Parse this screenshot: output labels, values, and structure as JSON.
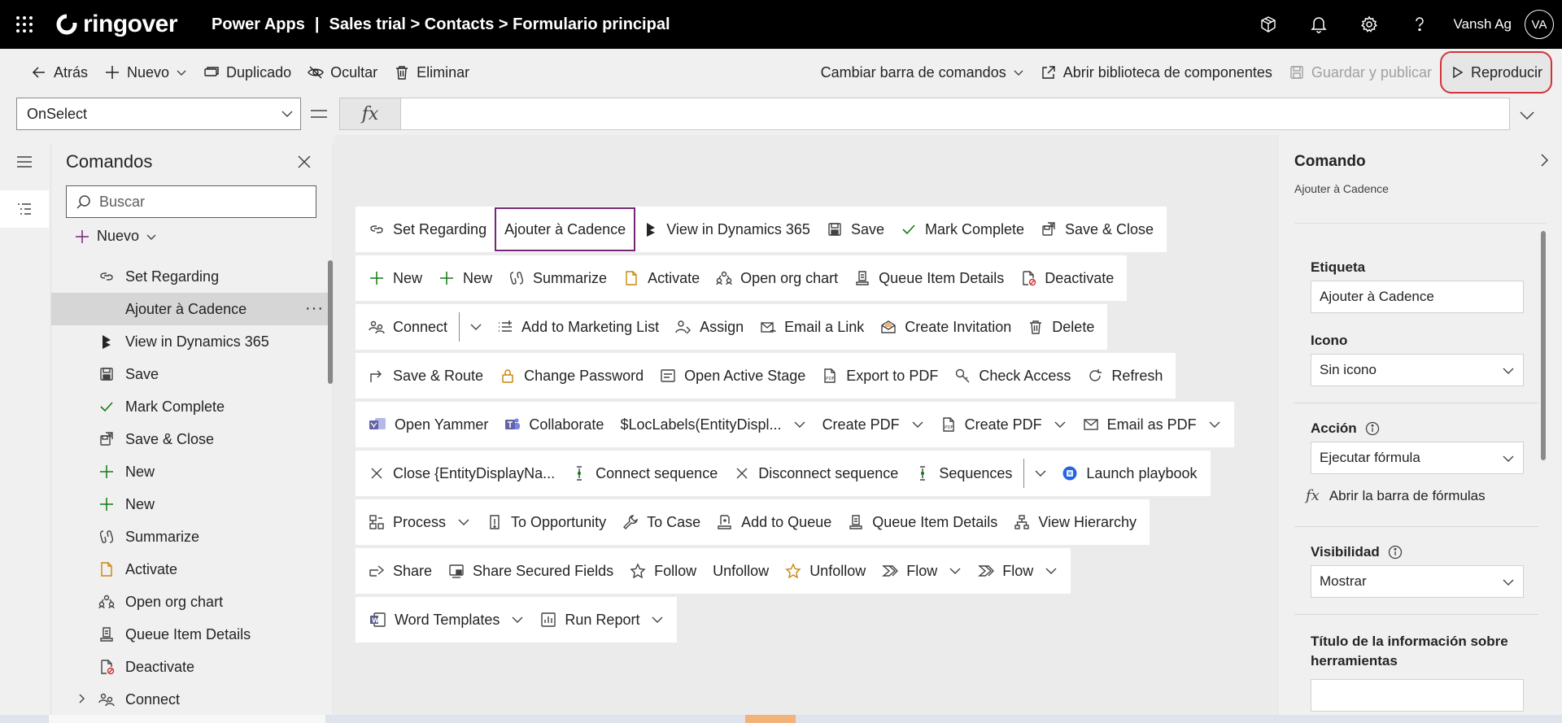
{
  "header": {
    "brand": "ringover",
    "app_name": "Power Apps",
    "separator": "|",
    "breadcrumb": "Sales trial > Contacts > Formulario principal",
    "user_name": "Vansh Ag",
    "user_initials": "VA",
    "icons": [
      "waffle-icon",
      "environment-icon",
      "bell-icon",
      "gear-icon",
      "help-icon"
    ]
  },
  "toolbar": {
    "back": "Atrás",
    "new": "Nuevo",
    "duplicate": "Duplicado",
    "hide": "Ocultar",
    "delete": "Eliminar",
    "change_commandbar": "Cambiar barra de comandos",
    "open_library": "Abrir biblioteca de componentes",
    "save_publish": "Guardar y publicar",
    "play": "Reproducir"
  },
  "formula_bar": {
    "property": "OnSelect",
    "fx": "fx",
    "formula": ""
  },
  "commands_panel": {
    "title": "Comandos",
    "search_placeholder": "Buscar",
    "new_label": "Nuevo",
    "items": [
      {
        "label": "Set Regarding",
        "icon": "link-icon"
      },
      {
        "label": "Ajouter à Cadence",
        "icon": "none",
        "selected": true
      },
      {
        "label": "View in Dynamics 365",
        "icon": "dynamics-icon"
      },
      {
        "label": "Save",
        "icon": "save-icon"
      },
      {
        "label": "Mark Complete",
        "icon": "checkmark-icon"
      },
      {
        "label": "Save & Close",
        "icon": "save-close-icon"
      },
      {
        "label": "New",
        "icon": "plus-icon"
      },
      {
        "label": "New",
        "icon": "plus-icon"
      },
      {
        "label": "Summarize",
        "icon": "copilot-icon"
      },
      {
        "label": "Activate",
        "icon": "document-icon"
      },
      {
        "label": "Open org chart",
        "icon": "org-chart-icon"
      },
      {
        "label": "Queue Item Details",
        "icon": "queue-icon"
      },
      {
        "label": "Deactivate",
        "icon": "deactivate-icon"
      },
      {
        "label": "Connect",
        "icon": "connect-icon",
        "expandable": true
      }
    ]
  },
  "canvas": {
    "rows": [
      [
        {
          "label": "Set Regarding",
          "icon": "link-icon"
        },
        {
          "label": "Ajouter à Cadence",
          "icon": "none",
          "selected": true
        },
        {
          "label": "View in Dynamics 365",
          "icon": "dynamics-icon"
        },
        {
          "label": "Save",
          "icon": "save-icon"
        },
        {
          "label": "Mark Complete",
          "icon": "checkmark-icon"
        },
        {
          "label": "Save & Close",
          "icon": "save-close-icon"
        }
      ],
      [
        {
          "label": "New",
          "icon": "plus-icon"
        },
        {
          "label": "New",
          "icon": "plus-icon"
        },
        {
          "label": "Summarize",
          "icon": "copilot-icon"
        },
        {
          "label": "Activate",
          "icon": "document-icon"
        },
        {
          "label": "Open org chart",
          "icon": "org-chart-icon"
        },
        {
          "label": "Queue Item Details",
          "icon": "queue-icon"
        },
        {
          "label": "Deactivate",
          "icon": "deactivate-icon"
        }
      ],
      [
        {
          "label": "Connect",
          "icon": "connect-icon",
          "split": true
        },
        {
          "label": "Add to Marketing List",
          "icon": "list-icon"
        },
        {
          "label": "Assign",
          "icon": "assign-icon"
        },
        {
          "label": "Email a Link",
          "icon": "email-link-icon"
        },
        {
          "label": "Create Invitation",
          "icon": "invitation-icon"
        },
        {
          "label": "Delete",
          "icon": "trash-icon"
        }
      ],
      [
        {
          "label": "Save & Route",
          "icon": "route-icon"
        },
        {
          "label": "Change Password",
          "icon": "lock-icon"
        },
        {
          "label": "Open Active Stage",
          "icon": "stage-icon"
        },
        {
          "label": "Export to PDF",
          "icon": "pdf-icon"
        },
        {
          "label": "Check Access",
          "icon": "key-icon"
        },
        {
          "label": "Refresh",
          "icon": "refresh-icon"
        }
      ],
      [
        {
          "label": "Open Yammer",
          "icon": "yammer-icon"
        },
        {
          "label": "Collaborate",
          "icon": "teams-icon"
        },
        {
          "label": "$LocLabels(EntityDispl...",
          "icon": "none",
          "caret": true
        },
        {
          "label": "Create PDF",
          "icon": "none",
          "caret": true
        },
        {
          "label": "Create PDF",
          "icon": "pdf-icon",
          "caret": true
        },
        {
          "label": "Email as PDF",
          "icon": "email-icon",
          "caret": true
        }
      ],
      [
        {
          "label": "Close {EntityDisplayNa...",
          "icon": "close-icon"
        },
        {
          "label": "Connect sequence",
          "icon": "sequence-icon"
        },
        {
          "label": "Disconnect sequence",
          "icon": "close-icon"
        },
        {
          "label": "Sequences",
          "icon": "sequence-icon",
          "split": true
        },
        {
          "label": "Launch playbook",
          "icon": "playbook-icon"
        }
      ],
      [
        {
          "label": "Process",
          "icon": "process-icon",
          "caret": true
        },
        {
          "label": "To Opportunity",
          "icon": "opportunity-icon"
        },
        {
          "label": "To Case",
          "icon": "wrench-icon"
        },
        {
          "label": "Add to Queue",
          "icon": "add-queue-icon"
        },
        {
          "label": "Queue Item Details",
          "icon": "queue-icon"
        },
        {
          "label": "View Hierarchy",
          "icon": "hierarchy-icon"
        }
      ],
      [
        {
          "label": "Share",
          "icon": "share-icon"
        },
        {
          "label": "Share Secured Fields",
          "icon": "secured-icon"
        },
        {
          "label": "Follow",
          "icon": "star-icon"
        },
        {
          "label": "Unfollow",
          "icon": "none"
        },
        {
          "label": "Unfollow",
          "icon": "star-outline-icon"
        },
        {
          "label": "Flow",
          "icon": "flow-icon",
          "caret": true
        },
        {
          "label": "Flow",
          "icon": "flow-icon",
          "caret": true
        }
      ],
      [
        {
          "label": "Word Templates",
          "icon": "word-icon",
          "caret": true
        },
        {
          "label": "Run Report",
          "icon": "report-icon",
          "caret": true
        }
      ]
    ]
  },
  "properties": {
    "title": "Comando",
    "subtitle": "Ajouter à Cadence",
    "label_title": "Etiqueta",
    "label_value": "Ajouter à Cadence",
    "icon_title": "Icono",
    "icon_value": "Sin icono",
    "action_title": "Acción",
    "action_value": "Ejecutar fórmula",
    "formula_link": "Abrir la barra de fórmulas",
    "visibility_title": "Visibilidad",
    "visibility_value": "Mostrar",
    "tooltip_title": "Título de la información sobre herramientas",
    "tooltip_value": ""
  },
  "colors": {
    "header_bg": "#000000",
    "selection_border": "#742774",
    "play_highlight": "#d13438",
    "check_green": "#107c10",
    "plus_green": "#107c10",
    "deactivate_red": "#d13438",
    "yammer_purple": "#6264a7",
    "playbook_blue": "#2266e3"
  }
}
